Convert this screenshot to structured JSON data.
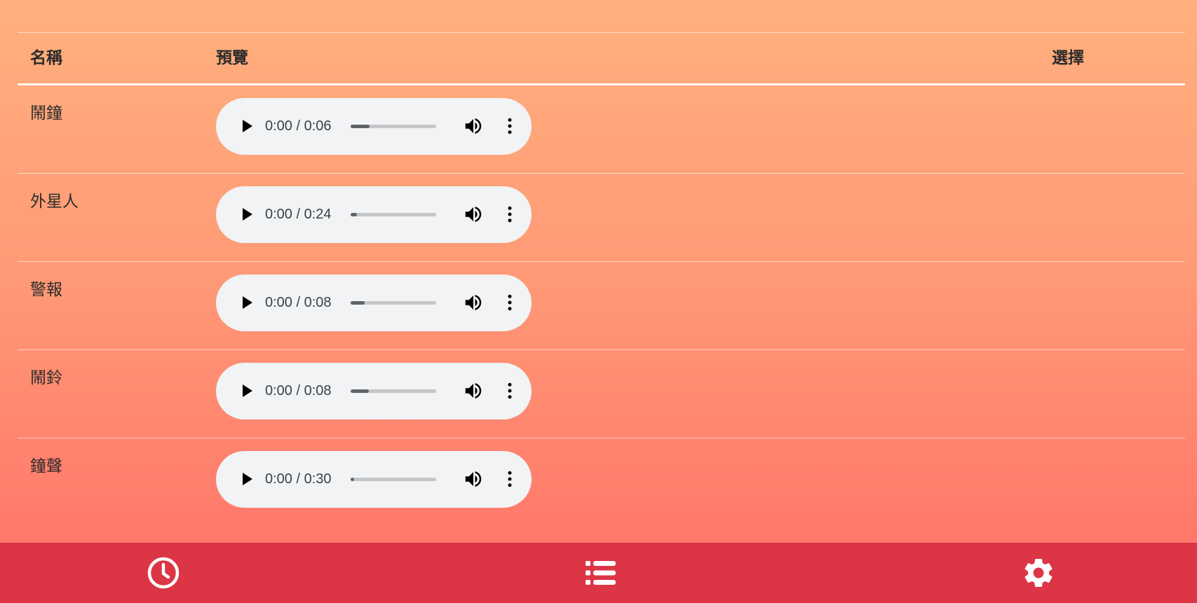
{
  "table": {
    "headers": {
      "name": "名稱",
      "preview": "預覽",
      "select": "選擇"
    },
    "rows": [
      {
        "name": "鬧鐘",
        "time": "0:00 / 0:06",
        "buffered": 0.22
      },
      {
        "name": "外星人",
        "time": "0:00 / 0:24",
        "buffered": 0.07
      },
      {
        "name": "警報",
        "time": "0:00 / 0:08",
        "buffered": 0.16
      },
      {
        "name": "鬧鈴",
        "time": "0:00 / 0:08",
        "buffered": 0.21
      },
      {
        "name": "鐘聲",
        "time": "0:00 / 0:30",
        "buffered": 0.04
      }
    ]
  },
  "player_icons": [
    "play-icon",
    "volume-icon",
    "more-vertical-icon"
  ],
  "bottom_nav": {
    "items": [
      {
        "icon": "clock-icon"
      },
      {
        "icon": "list-icon"
      },
      {
        "icon": "gear-icon"
      }
    ]
  },
  "colors": {
    "bottom_bar": "#dc3545",
    "gradient_top": "#ffb07e",
    "gradient_bottom": "#ff7068",
    "player_bg": "#f1f3f4"
  }
}
